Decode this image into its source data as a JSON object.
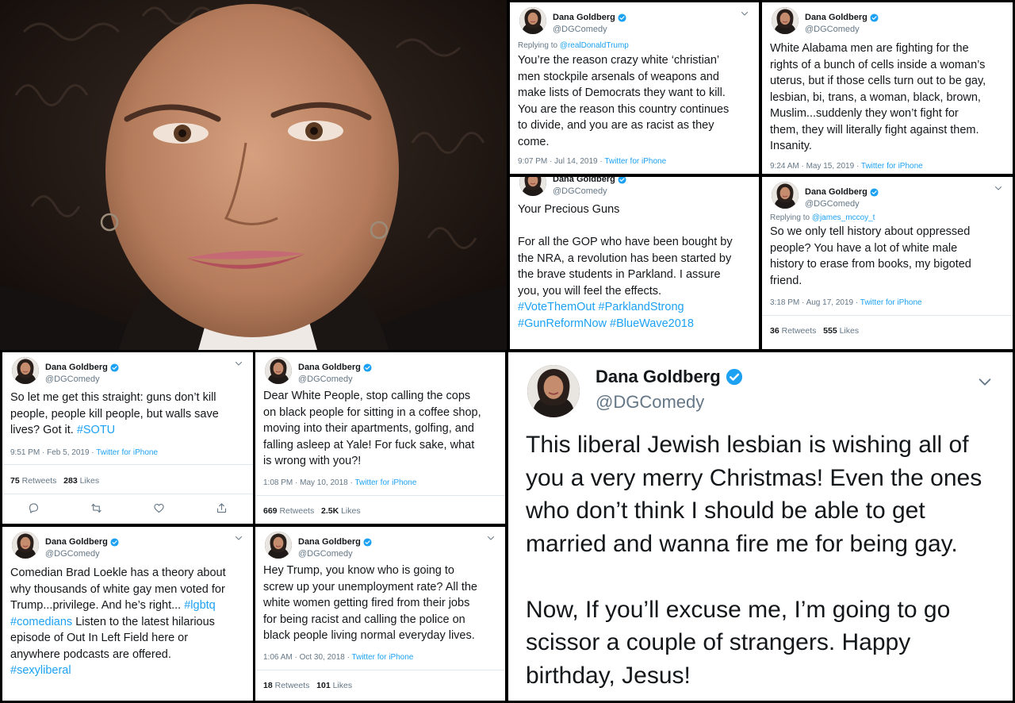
{
  "user": {
    "name": "Dana Goldberg",
    "handle": "@DGComedy"
  },
  "tweets": {
    "t1": {
      "reply_label": "Replying to ",
      "reply_to": "@realDonaldTrump",
      "text": "You’re the reason crazy white ‘christian’\nmen stockpile arsenals of weapons and\nmake lists of Democrats they want to kill.\nYou are the reason this country continues\nto divide, and you are as racist as they\ncome.",
      "time": "9:07 PM · Jul 14, 2019 · ",
      "source": "Twitter for iPhone"
    },
    "t2": {
      "text": "White Alabama men are fighting for the\nrights of a bunch of cells inside a woman’s\nuterus, but if those cells turn out to be gay,\nlesbian, bi, trans, a woman, black, brown,\nMuslim...suddenly they won’t fight for\nthem, they will literally fight against them.\nInsanity.",
      "time": "9:24 AM · May 15, 2019 · ",
      "source": "Twitter for iPhone"
    },
    "t3": {
      "text": "Your Precious Guns\n\nFor all the GOP who have been bought by\nthe NRA, a revolution has been started by\nthe brave students in Parkland. I assure\nyou, you will feel the effects.\n",
      "hashtags": "#VoteThemOut #ParklandStrong\n#GunReformNow #BlueWave2018"
    },
    "t4": {
      "reply_label": "Replying to ",
      "reply_to": "@james_mccoy_t",
      "text": "So we only tell history about oppressed\npeople? You have a lot of white male\nhistory to erase from books, my bigoted\nfriend.",
      "time": "3:18 PM · Aug 17, 2019 · ",
      "source": "Twitter for iPhone",
      "retweets": "36",
      "retweets_label": " Retweets",
      "likes": "555",
      "likes_label": " Likes"
    },
    "t5": {
      "text": "So let me get this straight: guns don’t kill\npeople, people kill people, but walls save\nlives? Got it. ",
      "hashtag": "#SOTU",
      "time": "9:51 PM · Feb 5, 2019 · ",
      "source": "Twitter for iPhone",
      "retweets": "75",
      "retweets_label": " Retweets",
      "likes": "283",
      "likes_label": " Likes"
    },
    "t6": {
      "text": "Dear White People, stop calling the cops\non black people for sitting in a coffee shop,\nmoving into their apartments, golfing, and\nfalling asleep at Yale! For fuck sake, what\nis wrong with you?!",
      "time": "1:08 PM · May 10, 2018 · ",
      "source": "Twitter for iPhone",
      "retweets": "669",
      "retweets_label": " Retweets",
      "likes": "2.5K",
      "likes_label": " Likes"
    },
    "t7": {
      "text1": "Comedian Brad Loekle has a theory about\nwhy thousands of white gay men voted for\nTrump...privilege. And he’s right... ",
      "hashtag1": "#lgbtq",
      "hashtag2": "#comedians",
      "text2": " Listen to the latest hilarious\nepisode of Out In Left Field here or\nanywhere podcasts are offered.\n",
      "hashtag3": "#sexyliberal"
    },
    "t8": {
      "text": "Hey Trump, you know who is going to\nscrew up your unemployment rate? All the\nwhite women getting fired from their jobs\nfor being racist and calling the police on\nblack people living normal everyday lives.",
      "time": "1:06 AM · Oct 30, 2018 · ",
      "source": "Twitter for iPhone",
      "retweets": "18",
      "retweets_label": " Retweets",
      "likes": "101",
      "likes_label": " Likes"
    },
    "t9": {
      "text": "This liberal Jewish lesbian is wishing all of\nyou a very merry Christmas! Even the ones\nwho don’t think I should be able to get\nmarried and wanna fire me for being gay.\n\nNow, If you’ll excuse me, I’m going to go\nscissor a couple of strangers. Happy\nbirthday, Jesus!"
    }
  },
  "colors": {
    "link": "#1da1f2",
    "muted": "#657786",
    "text": "#14171a",
    "divider": "#e1e8ed",
    "background": "#000000"
  },
  "icons": [
    "verified-badge-icon",
    "chevron-down-icon",
    "reply-icon",
    "retweet-icon",
    "like-icon",
    "share-icon"
  ]
}
